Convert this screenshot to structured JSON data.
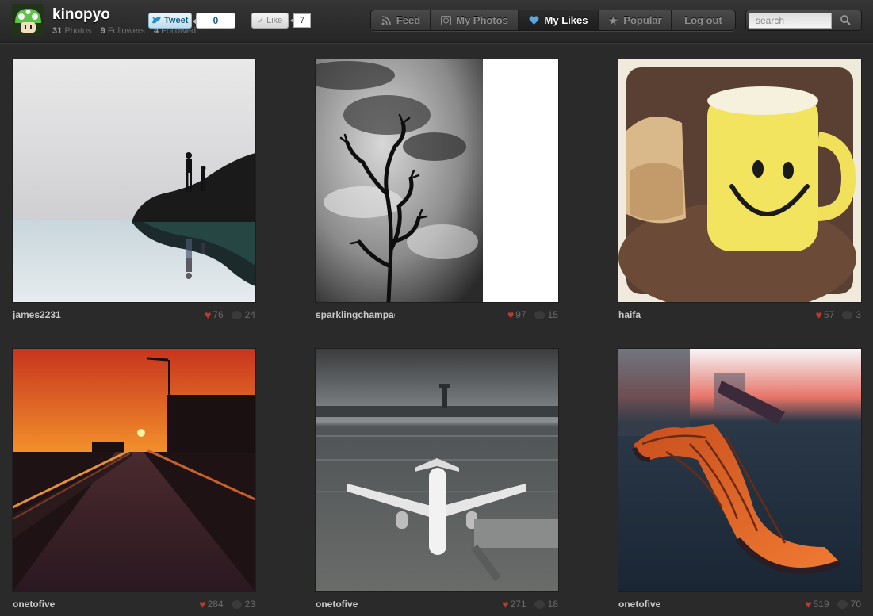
{
  "header": {
    "username": "kinopyo",
    "stats": [
      {
        "num": "31",
        "label": "Photos"
      },
      {
        "num": "9",
        "label": "Followers"
      },
      {
        "num": "4",
        "label": "Followed"
      }
    ],
    "tweet_label": "Tweet",
    "tweet_count": "0",
    "like_label": "Like",
    "like_count": "7"
  },
  "nav": {
    "items": [
      {
        "label": "Feed",
        "icon": "rss-icon"
      },
      {
        "label": "My Photos",
        "icon": "photo-icon"
      },
      {
        "label": "My Likes",
        "icon": "heart-icon",
        "active": true
      },
      {
        "label": "Popular",
        "icon": "star-icon"
      },
      {
        "label": "Log out",
        "icon": ""
      }
    ]
  },
  "search": {
    "placeholder": "search"
  },
  "photos": [
    {
      "author": "james2231",
      "likes": "76",
      "comments": "24"
    },
    {
      "author": "sparklingchampagne",
      "likes": "97",
      "comments": "15"
    },
    {
      "author": "haifa",
      "likes": "57",
      "comments": "3"
    },
    {
      "author": "onetofive",
      "likes": "284",
      "comments": "23"
    },
    {
      "author": "onetofive",
      "likes": "271",
      "comments": "18"
    },
    {
      "author": "onetofive",
      "likes": "519",
      "comments": "70"
    }
  ],
  "colors": {
    "background": "#2a2a2a",
    "heart": "#c0392b",
    "active_nav_text": "#ffffff"
  }
}
